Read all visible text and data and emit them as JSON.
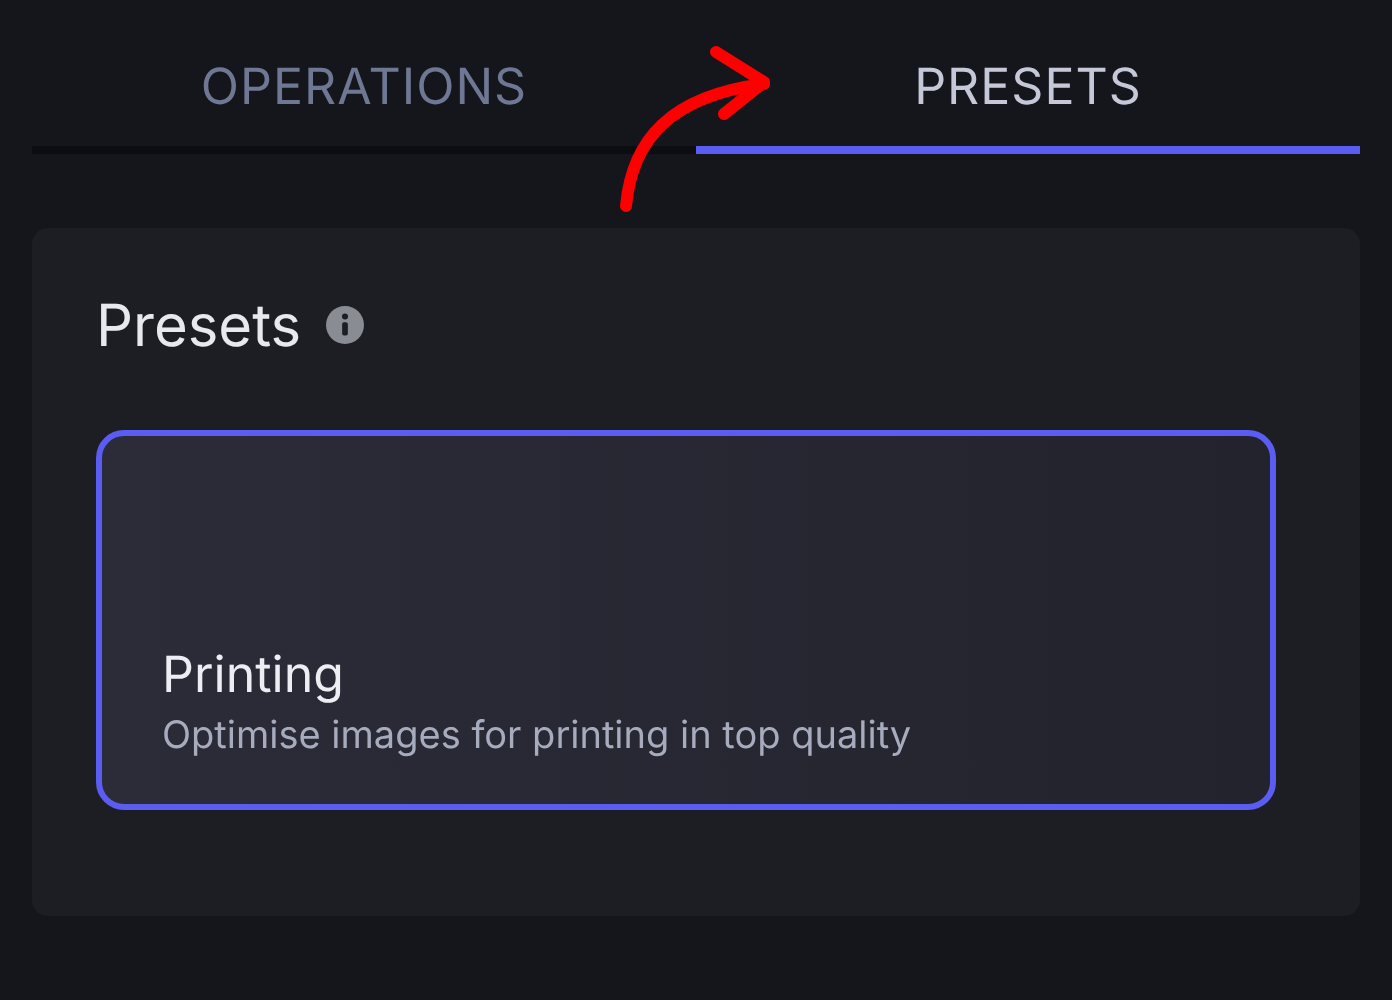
{
  "tabs": [
    {
      "label": "OPERATIONS",
      "selected": false
    },
    {
      "label": "PRESETS",
      "selected": true
    }
  ],
  "panel": {
    "title": "Presets",
    "presets": [
      {
        "name": "Printing",
        "description": "Optimise images for printing in top quality",
        "selected": true
      }
    ]
  }
}
